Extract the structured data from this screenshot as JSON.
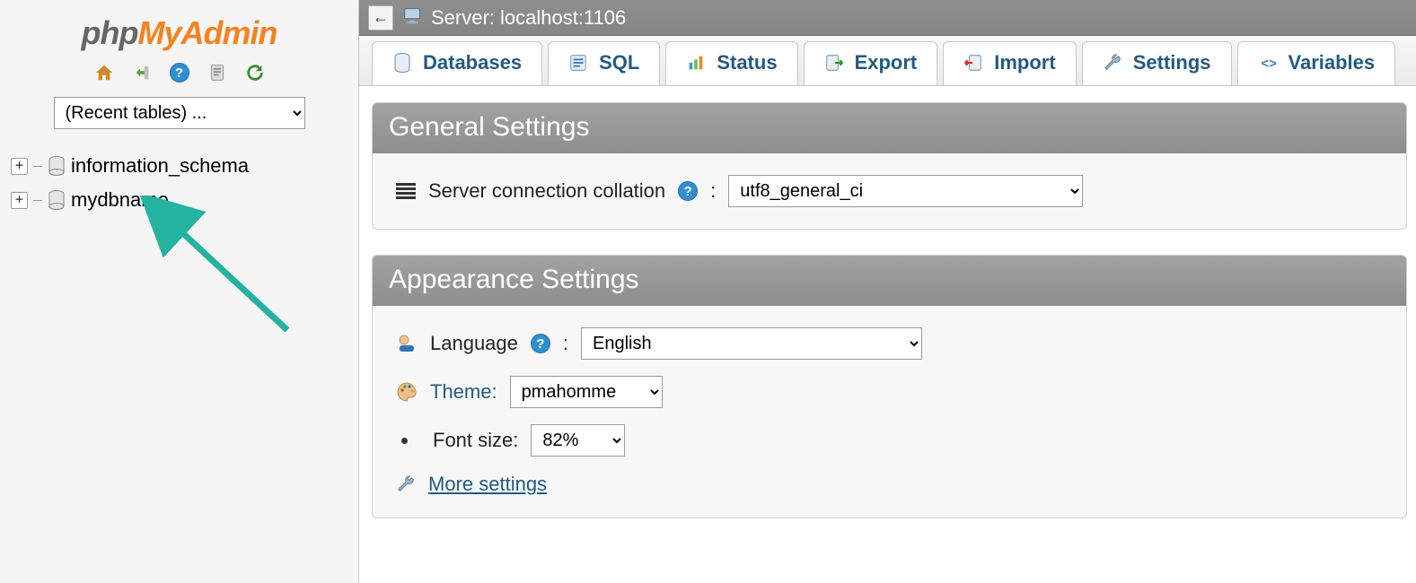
{
  "logo": {
    "php": "php",
    "my": "My",
    "admin": "Admin"
  },
  "sidebar": {
    "recent_placeholder": "(Recent tables) ...",
    "databases": [
      {
        "name": "information_schema"
      },
      {
        "name": "mydbname"
      }
    ]
  },
  "serverbar": {
    "label": "Server: localhost:1106"
  },
  "tabs": {
    "databases": "Databases",
    "sql": "SQL",
    "status": "Status",
    "export": "Export",
    "import": "Import",
    "settings": "Settings",
    "variables": "Variables"
  },
  "panels": {
    "general": {
      "title": "General Settings",
      "collation_label": "Server connection collation",
      "collation_value": "utf8_general_ci"
    },
    "appearance": {
      "title": "Appearance Settings",
      "language_label": "Language",
      "language_value": "English",
      "theme_label": "Theme:",
      "theme_value": "pmahomme",
      "fontsize_label": "Font size:",
      "fontsize_value": "82%",
      "more_link": "More settings"
    }
  }
}
